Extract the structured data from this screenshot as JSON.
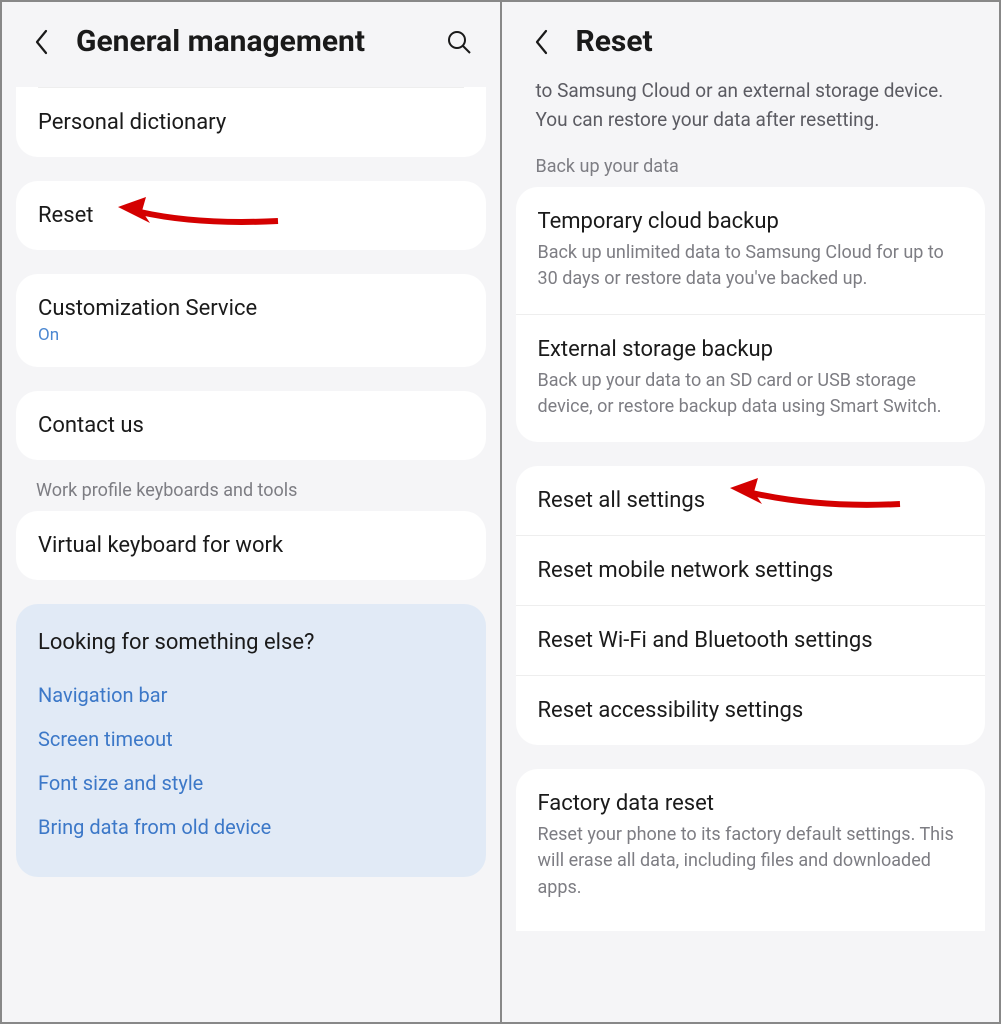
{
  "left": {
    "title": "General management",
    "items": {
      "personal_dictionary": "Personal dictionary",
      "reset": "Reset",
      "customization_service": "Customization Service",
      "customization_status": "On",
      "contact_us": "Contact us"
    },
    "work_section_label": "Work profile keyboards and tools",
    "work_item": "Virtual keyboard for work",
    "looking": {
      "title": "Looking for something else?",
      "links": [
        "Navigation bar",
        "Screen timeout",
        "Font size and style",
        "Bring data from old device"
      ]
    }
  },
  "right": {
    "title": "Reset",
    "intro": "to Samsung Cloud or an external storage device. You can restore your data after resetting.",
    "backup_label": "Back up your data",
    "backup_items": [
      {
        "title": "Temporary cloud backup",
        "desc": "Back up unlimited data to Samsung Cloud for up to 30 days or restore data you've backed up."
      },
      {
        "title": "External storage backup",
        "desc": "Back up your data to an SD card or USB storage device, or restore backup data using Smart Switch."
      }
    ],
    "reset_items": [
      "Reset all settings",
      "Reset mobile network settings",
      "Reset Wi-Fi and Bluetooth settings",
      "Reset accessibility settings"
    ],
    "factory": {
      "title": "Factory data reset",
      "desc": "Reset your phone to its factory default settings. This will erase all data, including files and downloaded apps."
    }
  }
}
